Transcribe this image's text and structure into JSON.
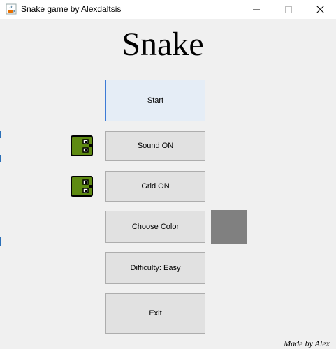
{
  "window": {
    "title": "Snake game by Alexdaltsis",
    "icon": "java-cup-icon",
    "controls": [
      "minimize-icon",
      "maximize-icon",
      "close-icon"
    ]
  },
  "heading": "Snake",
  "buttons": {
    "start": "Start",
    "sound": "Sound ON",
    "grid": "Grid ON",
    "color": "Choose Color",
    "difficulty": "Difficulty: Easy",
    "exit": "Exit"
  },
  "indicators": {
    "sound_icon": "snake-head-icon",
    "grid_icon": "snake-head-icon",
    "snake_color": "#5e8a12"
  },
  "selected_color": "#808080",
  "credit": "Made by Alex"
}
